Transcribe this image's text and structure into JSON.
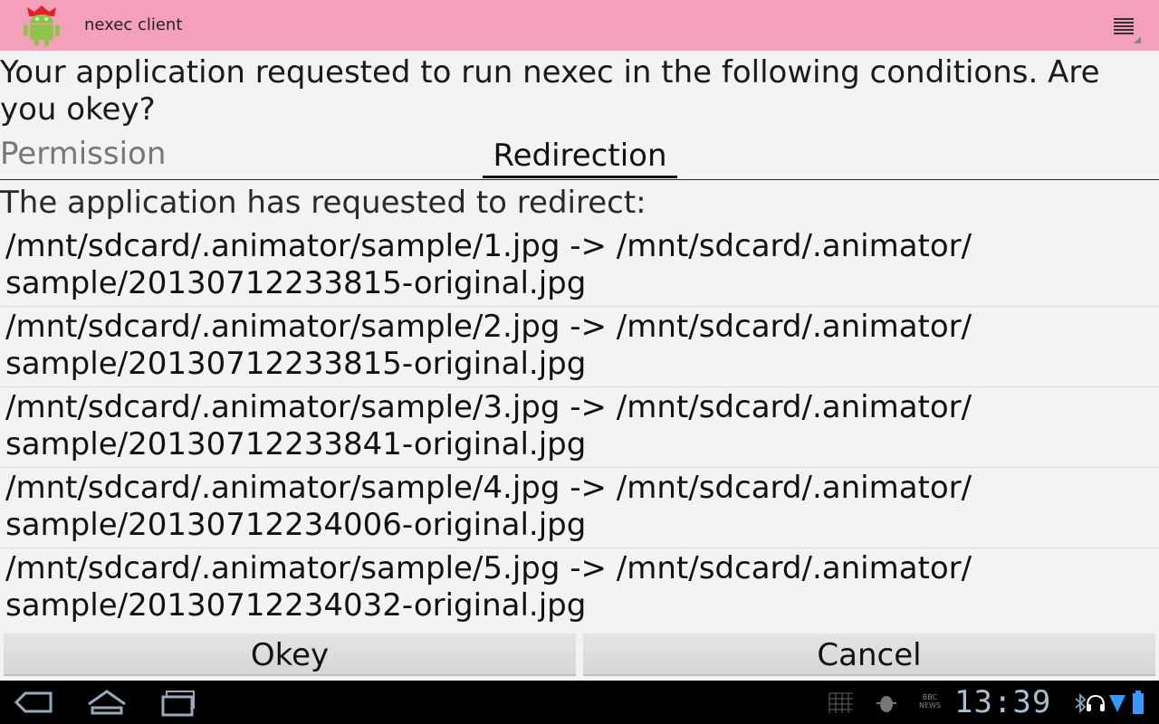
{
  "app": {
    "title": "nexec client"
  },
  "dialog": {
    "prompt": "Your application requested to run nexec in the following conditions. Are you okey?",
    "tabs": [
      {
        "label": "Permission",
        "selected": false
      },
      {
        "label": "Redirection",
        "selected": true
      }
    ],
    "intro": "The application has requested to redirect:",
    "redirects": [
      {
        "line1": "/mnt/sdcard/.animator/sample/1.jpg -> /mnt/sdcard/.animator/",
        "line2": "sample/20130712233815-original.jpg"
      },
      {
        "line1": "/mnt/sdcard/.animator/sample/2.jpg -> /mnt/sdcard/.animator/",
        "line2": "sample/20130712233815-original.jpg"
      },
      {
        "line1": "/mnt/sdcard/.animator/sample/3.jpg -> /mnt/sdcard/.animator/",
        "line2": "sample/20130712233841-original.jpg"
      },
      {
        "line1": "/mnt/sdcard/.animator/sample/4.jpg -> /mnt/sdcard/.animator/",
        "line2": "sample/20130712234006-original.jpg"
      },
      {
        "line1": "/mnt/sdcard/.animator/sample/5.jpg -> /mnt/sdcard/.animator/",
        "line2": "sample/20130712234032-original.jpg"
      }
    ],
    "okey_label": "Okey",
    "cancel_label": "Cancel"
  },
  "system_bar": {
    "clock": "13:39",
    "icons": [
      "back-icon",
      "home-icon",
      "recent-apps-icon",
      "grid-notification-icon",
      "android-debug-icon",
      "bbc-news-icon",
      "bluetooth-icon",
      "headset-icon",
      "wifi-signal-icon",
      "battery-icon"
    ],
    "bbc_news_text": "BBC NEWS"
  },
  "colors": {
    "action_bar": "#f5a0bb",
    "background": "#f3f3f3",
    "clock": "#a9bfd0"
  }
}
